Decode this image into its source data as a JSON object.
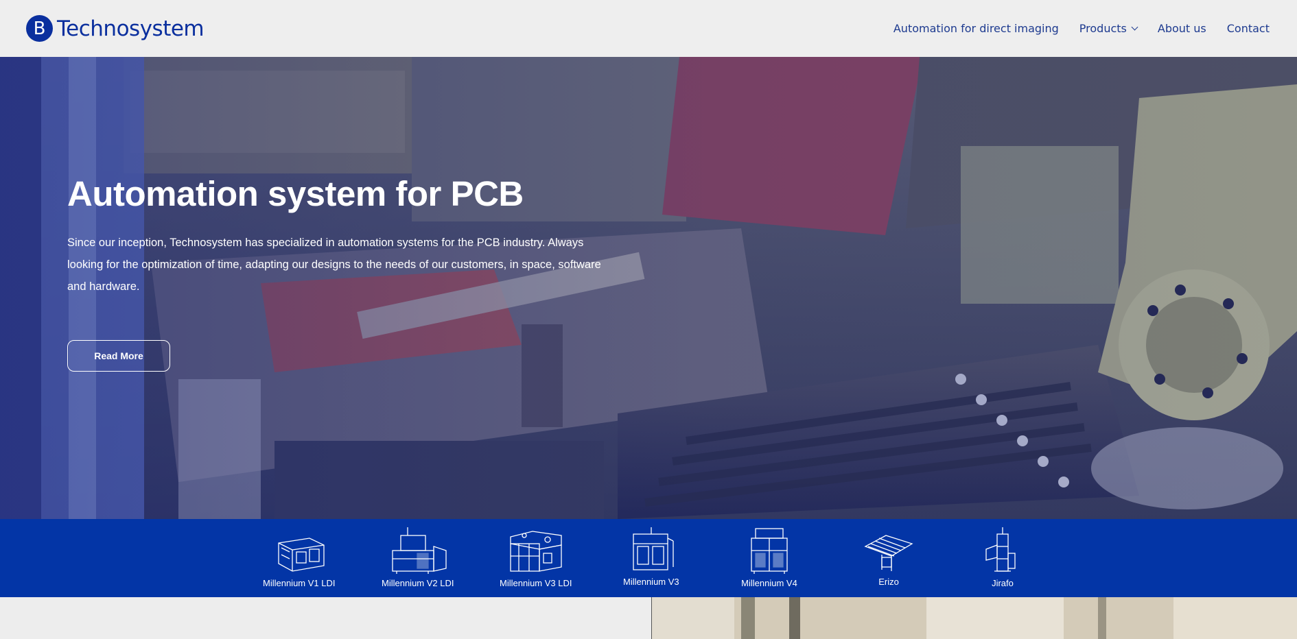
{
  "header": {
    "logo_letter": "B",
    "brand": "Technosystem",
    "nav": [
      {
        "label": "Automation for direct imaging"
      },
      {
        "label": "Products"
      },
      {
        "label": "About us"
      },
      {
        "label": "Contact"
      }
    ]
  },
  "hero": {
    "title": "Automation system for PCB",
    "text": "Since our inception, Technosystem has specialized in automation systems for the PCB industry. Always looking for the optimization of time, adapting our designs to the needs of our customers, in space, software and hardware.",
    "button": "Read More"
  },
  "products": [
    {
      "label": "Millennium V1 LDI"
    },
    {
      "label": "Millennium V2 LDI"
    },
    {
      "label": "Millennium V3 LDI"
    },
    {
      "label": "Millennium V3"
    },
    {
      "label": "Millennium V4"
    },
    {
      "label": "Erizo"
    },
    {
      "label": "Jirafo"
    }
  ],
  "colors": {
    "brand_blue": "#0a2f9e",
    "strip_blue": "#0335a6",
    "header_bg": "#eeeeee"
  }
}
